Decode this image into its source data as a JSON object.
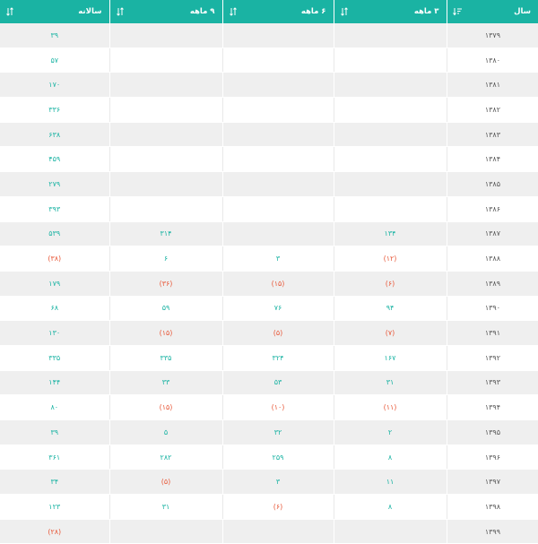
{
  "table": {
    "headers": [
      {
        "key": "year",
        "label": "سال"
      },
      {
        "key": "q3",
        "label": "۳ ماهه"
      },
      {
        "key": "q6",
        "label": "۶ ماهه"
      },
      {
        "key": "q9",
        "label": "۹ ماهه"
      },
      {
        "key": "yearly",
        "label": "سالانه"
      }
    ],
    "rows": [
      {
        "year": "۱۳۷۹",
        "q3": "",
        "q6": "",
        "q9": "",
        "yearly": "۳۹"
      },
      {
        "year": "۱۳۸۰",
        "q3": "",
        "q6": "",
        "q9": "",
        "yearly": "۵۷"
      },
      {
        "year": "۱۳۸۱",
        "q3": "",
        "q6": "",
        "q9": "",
        "yearly": "۱۷۰"
      },
      {
        "year": "۱۳۸۲",
        "q3": "",
        "q6": "",
        "q9": "",
        "yearly": "۳۳۶"
      },
      {
        "year": "۱۳۸۳",
        "q3": "",
        "q6": "",
        "q9": "",
        "yearly": "۶۳۸"
      },
      {
        "year": "۱۳۸۴",
        "q3": "",
        "q6": "",
        "q9": "",
        "yearly": "۴۵۹"
      },
      {
        "year": "۱۳۸۵",
        "q3": "",
        "q6": "",
        "q9": "",
        "yearly": "۲۷۹"
      },
      {
        "year": "۱۳۸۶",
        "q3": "",
        "q6": "",
        "q9": "",
        "yearly": "۳۹۳"
      },
      {
        "year": "۱۳۸۷",
        "q3": "۱۳۴",
        "q6": "",
        "q9": "۳۱۴",
        "yearly": "۵۳۹"
      },
      {
        "year": "۱۳۸۸",
        "q3": "(۱۲)",
        "q6": "۳",
        "q9": "۶",
        "yearly": "(۳۸)"
      },
      {
        "year": "۱۳۸۹",
        "q3": "(۶)",
        "q6": "(۱۵)",
        "q9": "(۳۶)",
        "yearly": "۱۷۹"
      },
      {
        "year": "۱۳۹۰",
        "q3": "۹۴",
        "q6": "۷۶",
        "q9": "۵۹",
        "yearly": "۶۸"
      },
      {
        "year": "۱۳۹۱",
        "q3": "(۷)",
        "q6": "(۵)",
        "q9": "(۱۵)",
        "yearly": "۱۳۰"
      },
      {
        "year": "۱۳۹۲",
        "q3": "۱۶۷",
        "q6": "۳۲۴",
        "q9": "۳۳۵",
        "yearly": "۳۳۵"
      },
      {
        "year": "۱۳۹۳",
        "q3": "۳۱",
        "q6": "۵۳",
        "q9": "۳۳",
        "yearly": "۱۴۴"
      },
      {
        "year": "۱۳۹۴",
        "q3": "(۱۱)",
        "q6": "(۱۰)",
        "q9": "(۱۵)",
        "yearly": "۸۰"
      },
      {
        "year": "۱۳۹۵",
        "q3": "۲",
        "q6": "۳۲",
        "q9": "۵",
        "yearly": "۳۹"
      },
      {
        "year": "۱۳۹۶",
        "q3": "۸",
        "q6": "۲۵۹",
        "q9": "۲۸۲",
        "yearly": "۳۶۱"
      },
      {
        "year": "۱۳۹۷",
        "q3": "۱۱",
        "q6": "۳",
        "q9": "(۵)",
        "yearly": "۳۴"
      },
      {
        "year": "۱۳۹۸",
        "q3": "۸",
        "q6": "(۶)",
        "q9": "۳۱",
        "yearly": "۱۲۳"
      },
      {
        "year": "۱۳۹۹",
        "q3": "",
        "q6": "",
        "q9": "",
        "yearly": "(۲۸)"
      }
    ]
  },
  "colors": {
    "header_bg": "#1ab3a3",
    "positive": "#1ab3a3",
    "negative": "#e8593a",
    "row_stripe": "#efefef"
  },
  "icons": {
    "year_sort": "sort-descending-icon",
    "column_sort": "sort-both-icon"
  }
}
